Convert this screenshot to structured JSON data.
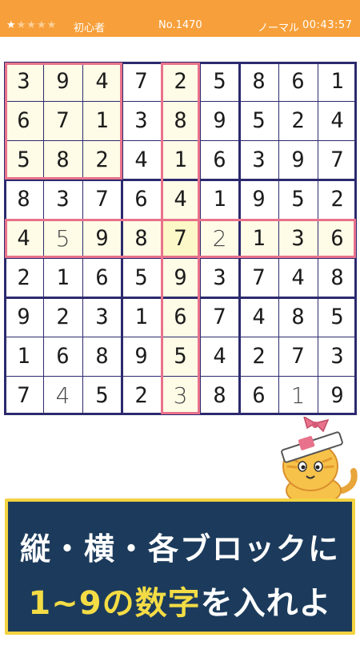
{
  "header": {
    "stars_filled": "★",
    "stars_empty": "★★★★",
    "level": "初心者",
    "puzzle_no": "No.1470",
    "mode": "ノーマル",
    "timer": "00:43:57"
  },
  "board": {
    "rows": [
      [
        "3",
        "9",
        "4",
        "7",
        "2",
        "5",
        "8",
        "6",
        "1"
      ],
      [
        "6",
        "7",
        "1",
        "3",
        "8",
        "9",
        "5",
        "2",
        "4"
      ],
      [
        "5",
        "8",
        "2",
        "4",
        "1",
        "6",
        "3",
        "9",
        "7"
      ],
      [
        "8",
        "3",
        "7",
        "6",
        "4",
        "1",
        "9",
        "5",
        "2"
      ],
      [
        "4",
        "5",
        "9",
        "8",
        "7",
        "2",
        "1",
        "3",
        "6"
      ],
      [
        "2",
        "1",
        "6",
        "5",
        "9",
        "3",
        "7",
        "4",
        "8"
      ],
      [
        "9",
        "2",
        "3",
        "1",
        "6",
        "7",
        "4",
        "8",
        "5"
      ],
      [
        "1",
        "6",
        "8",
        "9",
        "5",
        "4",
        "2",
        "7",
        "3"
      ],
      [
        "7",
        "4",
        "5",
        "2",
        "3",
        "8",
        "6",
        "1",
        "9"
      ]
    ],
    "user_entered": [
      [
        4,
        1
      ],
      [
        4,
        5
      ],
      [
        8,
        1
      ],
      [
        8,
        4
      ],
      [
        8,
        7
      ]
    ],
    "selected": [
      4,
      4
    ]
  },
  "banner": {
    "line1": "縦・横・各ブロックに",
    "line2_highlight": "1~9の数字",
    "line2_rest": "を入れよう！"
  },
  "colors": {
    "header_bg": "#f7a03b",
    "grid_line": "#2c2a6e",
    "highlight_border": "#e8728b",
    "banner_bg": "#1c3b5c",
    "banner_border": "#f2d341",
    "banner_highlight": "#f4dc45"
  }
}
